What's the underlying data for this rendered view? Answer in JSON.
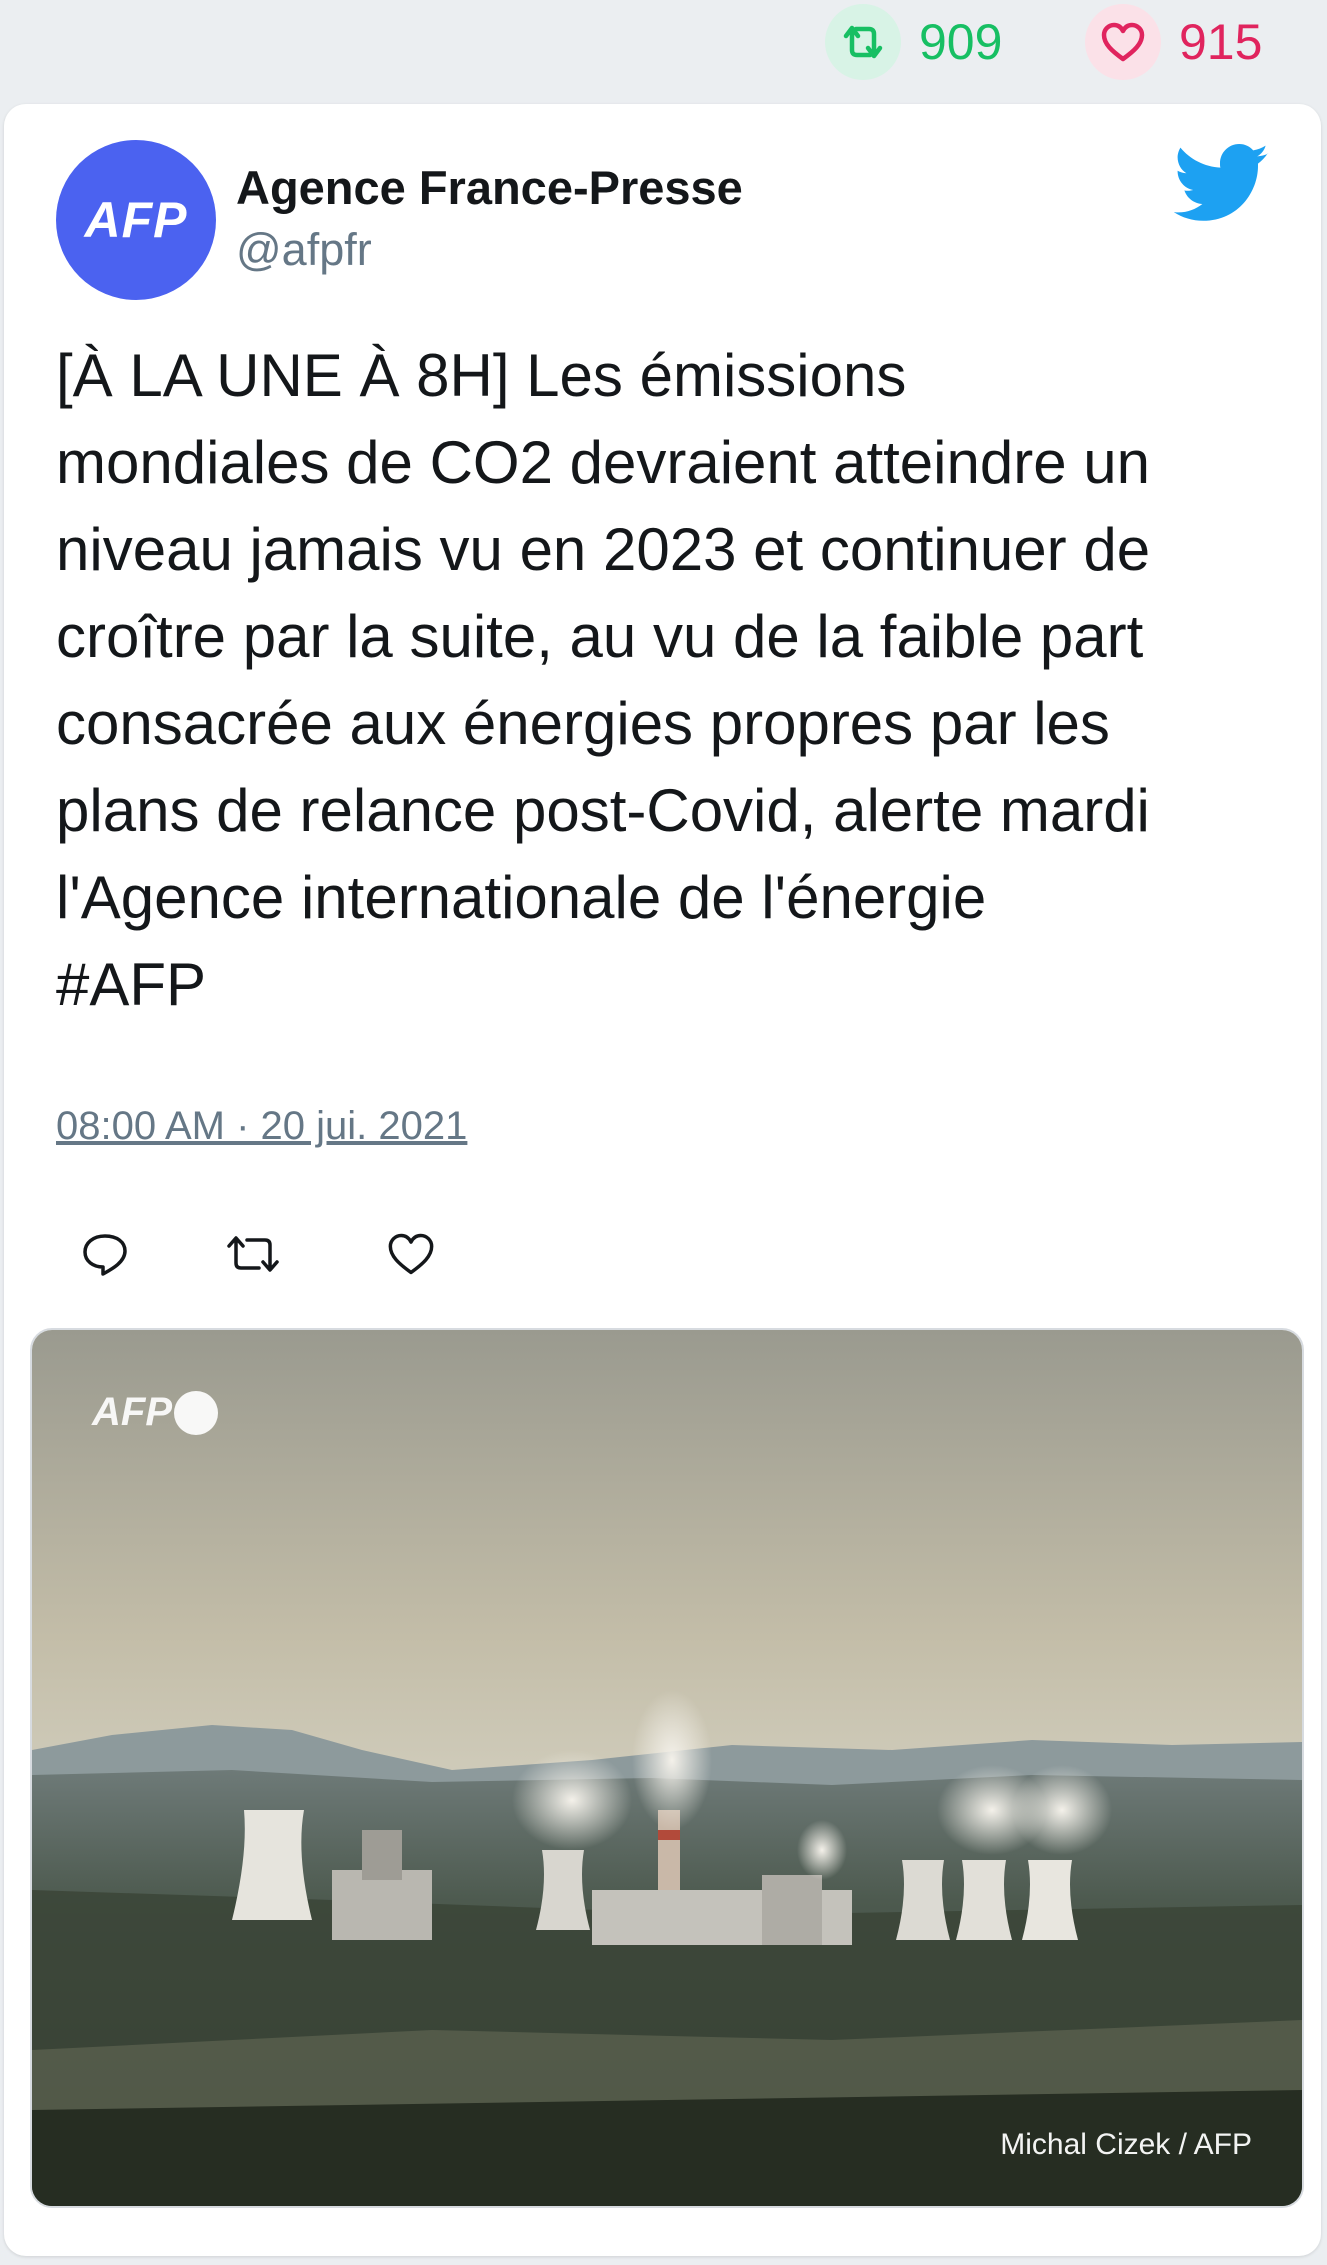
{
  "stats": {
    "retweets": "909",
    "likes": "915"
  },
  "account": {
    "avatar_text": "AFP",
    "name": "Agence France-Presse",
    "handle": "@afpfr"
  },
  "tweet": {
    "text": "[À LA UNE À 8H] Les émissions\nmondiales de CO2 devraient atteindre un\nniveau jamais vu en 2023 et continuer de\ncroître par la suite, au vu de la faible part\nconsacrée aux énergies propres par les\nplans de relance post-Covid, alerte mardi\nl'Agence internationale de l'énergie\n#AFP",
    "timestamp": "08:00 AM · 20 jui. 2021"
  },
  "photo": {
    "watermark": "AFP",
    "credit": "Michal Cizek / AFP"
  },
  "icons": {
    "retweet": "retweet-icon",
    "like": "heart-icon",
    "reply": "reply-icon",
    "brand": "twitter-bird-icon"
  },
  "colors": {
    "retweet": "#17bf63",
    "like": "#e0245e",
    "twitter_blue": "#1da1f2",
    "avatar_bg": "#4b62f0"
  }
}
